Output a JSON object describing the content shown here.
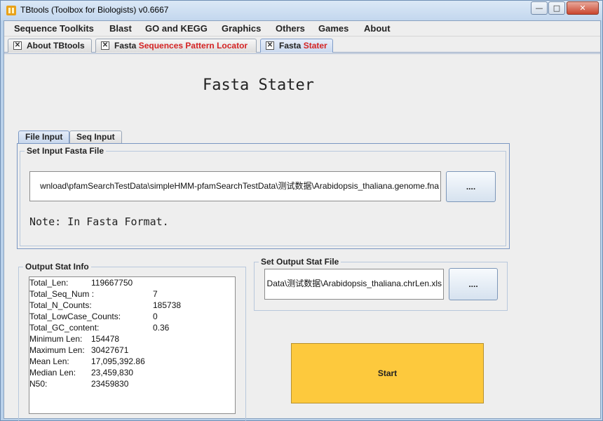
{
  "window": {
    "title": "TBtools (Toolbox for Biologists) v0.6667",
    "minimize_label": "—",
    "maximize_label": "□",
    "close_label": "✕"
  },
  "menubar": {
    "items": [
      "Sequence Toolkits",
      "Blast",
      "GO and KEGG",
      "Graphics",
      "Others",
      "Games",
      "About"
    ]
  },
  "doc_tabs": [
    {
      "label_plain": "About TBtools",
      "label_highlight": ""
    },
    {
      "label_plain": "Fasta ",
      "label_highlight": "Sequences Pattern Locator"
    },
    {
      "label_plain": "Fasta ",
      "label_highlight": "Stater"
    }
  ],
  "tab_close_glyph": "✕",
  "main": {
    "title": "Fasta Stater",
    "sub_tabs": [
      "File Input",
      "Seq Input"
    ],
    "input_group_label": "Set Input Fasta File",
    "input_path": "wnload\\pfamSearchTestData\\simpleHMM-pfamSearchTestData\\测试数据\\Arabidopsis_thaliana.genome.fna",
    "browse_label": "....",
    "note": "Note: In Fasta Format.",
    "output_info_label": "Output Stat Info",
    "output_file_label": "Set Output Stat File",
    "output_path": "Data\\测试数据\\Arabidopsis_thaliana.chrLen.xls",
    "output_browse_label": "....",
    "start_label": "Start"
  },
  "stats": [
    {
      "key": "Total_Len:",
      "value": "119667750"
    },
    {
      "key": "Total_Seq_Num :",
      "value": "7"
    },
    {
      "key": "Total_N_Counts:",
      "value": "185738"
    },
    {
      "key": "Total_LowCase_Counts:",
      "value": "0"
    },
    {
      "key": "Total_GC_content:",
      "value": "0.36"
    },
    {
      "key": "Minimum Len:",
      "value": "154478"
    },
    {
      "key": "Maximum Len:",
      "value": "30427671"
    },
    {
      "key": "Mean Len:",
      "value": "17,095,392.86"
    },
    {
      "key": "Median Len:",
      "value": "23,459,830"
    },
    {
      "key": "N50:",
      "value": "23459830"
    }
  ],
  "colors": {
    "accent_tab_text": "#d42323",
    "start_button": "#fdc93d",
    "title_bar": "#c3d7ee"
  },
  "icons": {
    "app": "tbtools-app-icon",
    "tab_close": "close-icon"
  }
}
